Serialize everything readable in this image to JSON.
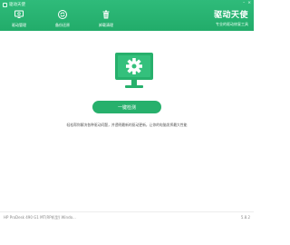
{
  "app": {
    "title": "驱动天使",
    "brand_name": "驱动天使",
    "brand_subtitle": "专业的驱动修复工具",
    "window_controls": [
      "–",
      "×"
    ]
  },
  "nav": [
    {
      "label": "驱动管理",
      "icon": "monitor-gear-icon"
    },
    {
      "label": "备份还原",
      "icon": "refresh-icon"
    },
    {
      "label": "卸载清理",
      "icon": "trash-icon"
    }
  ],
  "main": {
    "scan_button": "一键检测",
    "description": "轻松帮你解决各种驱动问题，并透明最新的驱动更新，让你的电脑发挥最大性能"
  },
  "footer": {
    "device": "HP ProDesk 490 G1 MT(RP机型) Windo...",
    "version": "5.8.2"
  },
  "colors": {
    "accent": "#27b06c",
    "header": "#2fbb7a"
  }
}
